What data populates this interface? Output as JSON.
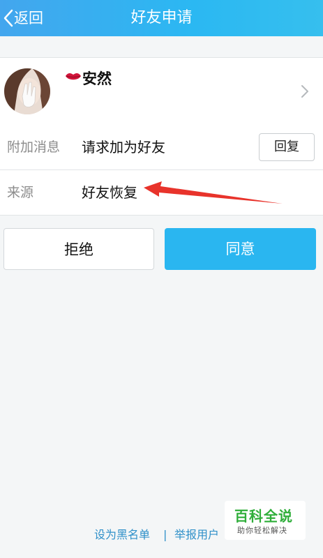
{
  "header": {
    "back_label": "返回",
    "title": "好友申请"
  },
  "profile": {
    "name": "安然"
  },
  "info": {
    "message_label": "附加消息",
    "message_value": "请求加为好友",
    "reply_label": "回复",
    "source_label": "来源",
    "source_value": "好友恢复"
  },
  "actions": {
    "reject_label": "拒绝",
    "accept_label": "同意"
  },
  "footer": {
    "blacklist_label": "设为黑名单",
    "separator": "|",
    "report_label": "举报用户"
  },
  "watermark": {
    "main": "百科全说",
    "sub": "助你轻松解决"
  },
  "colors": {
    "header_bg": "#2bb8f2",
    "accept_bg": "#2ab6f0",
    "link": "#2f90c9",
    "arrow": "#e8332b",
    "watermark_green": "#2fae3a"
  }
}
